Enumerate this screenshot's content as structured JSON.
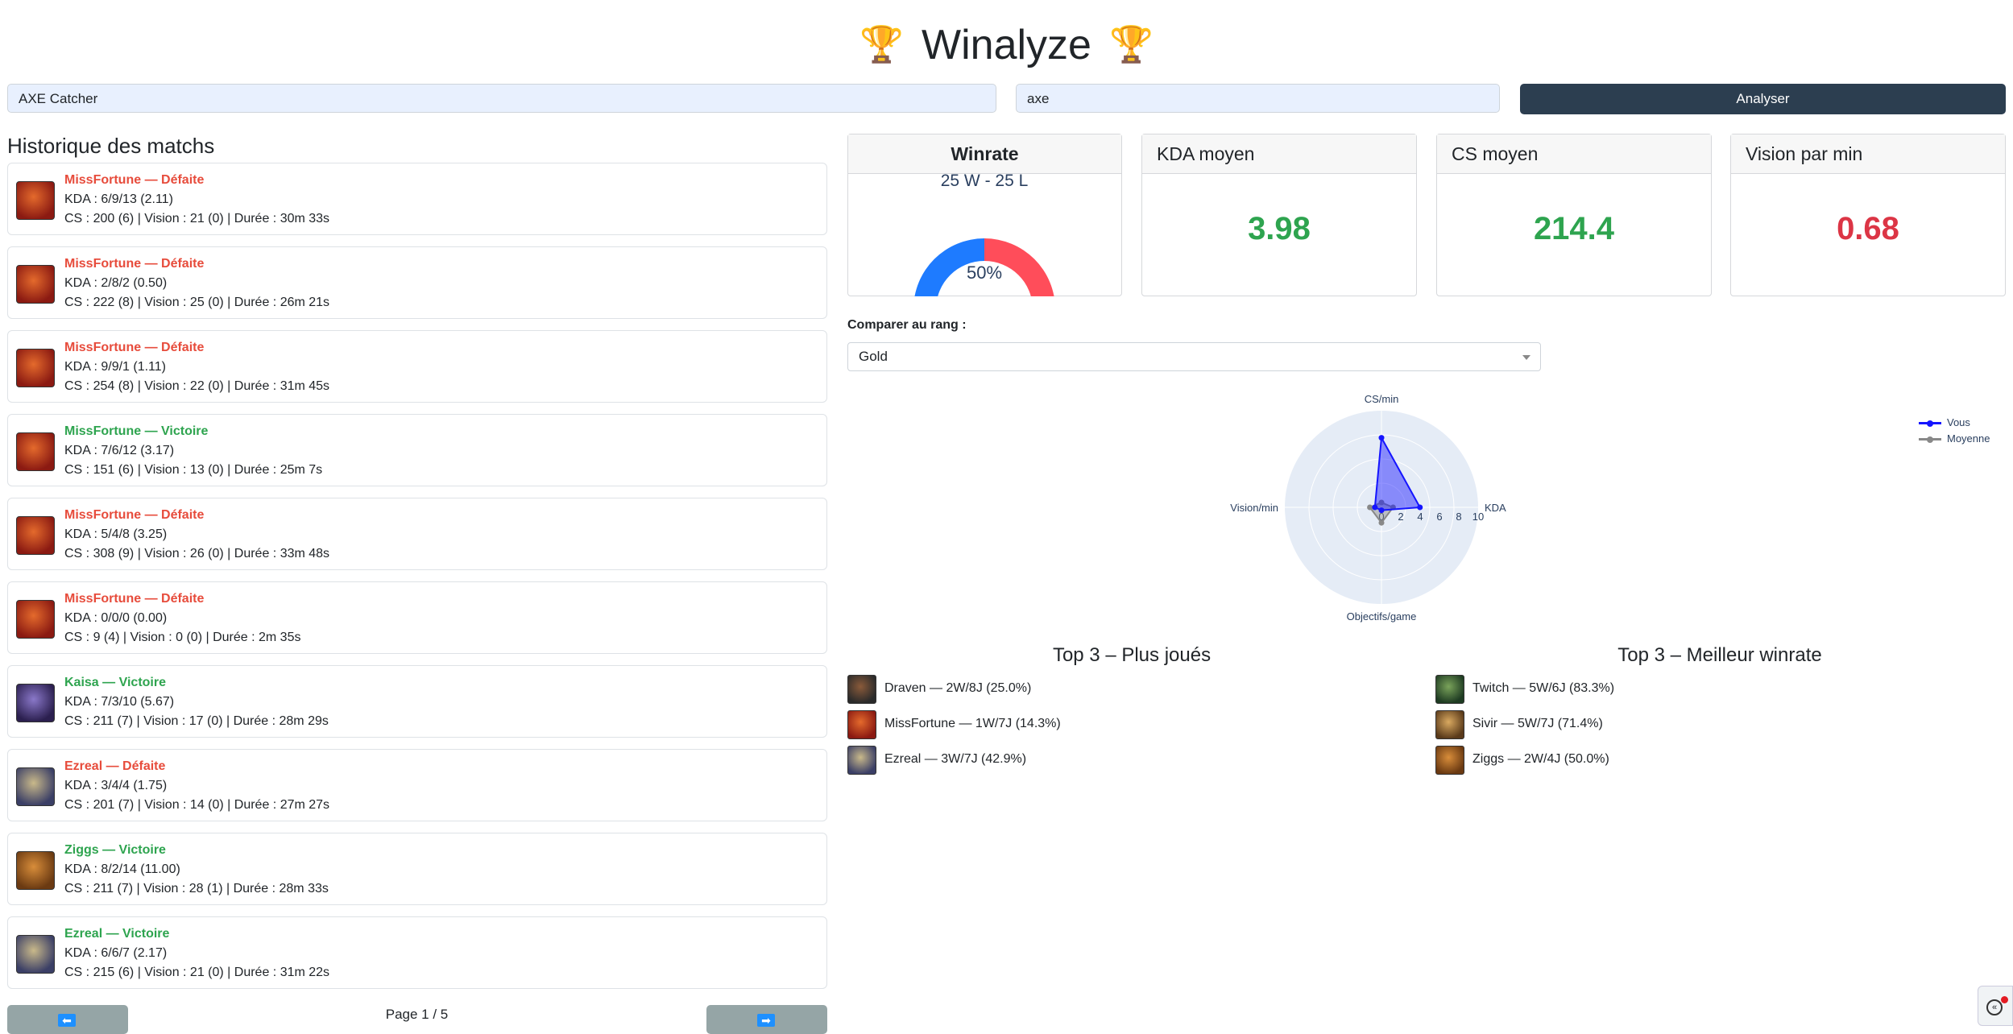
{
  "header": {
    "title": "Winalyze",
    "trophy": "🏆"
  },
  "search": {
    "summoner": "AXE Catcher",
    "tag": "axe",
    "analyze_label": "Analyser"
  },
  "history": {
    "title": "Historique des matchs",
    "matches": [
      {
        "title": "MissFortune — Défaite",
        "result": "loss",
        "kda": "KDA : 6/9/13 (2.11)",
        "stats": "CS : 200 (6) | Vision : 21 (0) | Durée : 30m 33s",
        "champion": "MissFortune"
      },
      {
        "title": "MissFortune — Défaite",
        "result": "loss",
        "kda": "KDA : 2/8/2 (0.50)",
        "stats": "CS : 222 (8) | Vision : 25 (0) | Durée : 26m 21s",
        "champion": "MissFortune"
      },
      {
        "title": "MissFortune — Défaite",
        "result": "loss",
        "kda": "KDA : 9/9/1 (1.11)",
        "stats": "CS : 254 (8) | Vision : 22 (0) | Durée : 31m 45s",
        "champion": "MissFortune"
      },
      {
        "title": "MissFortune — Victoire",
        "result": "win",
        "kda": "KDA : 7/6/12 (3.17)",
        "stats": "CS : 151 (6) | Vision : 13 (0) | Durée : 25m 7s",
        "champion": "MissFortune"
      },
      {
        "title": "MissFortune — Défaite",
        "result": "loss",
        "kda": "KDA : 5/4/8 (3.25)",
        "stats": "CS : 308 (9) | Vision : 26 (0) | Durée : 33m 48s",
        "champion": "MissFortune"
      },
      {
        "title": "MissFortune — Défaite",
        "result": "loss",
        "kda": "KDA : 0/0/0 (0.00)",
        "stats": "CS : 9 (4) | Vision : 0 (0) | Durée : 2m 35s",
        "champion": "MissFortune"
      },
      {
        "title": "Kaisa — Victoire",
        "result": "win",
        "kda": "KDA : 7/3/10 (5.67)",
        "stats": "CS : 211 (7) | Vision : 17 (0) | Durée : 28m 29s",
        "champion": "Kaisa"
      },
      {
        "title": "Ezreal — Défaite",
        "result": "loss",
        "kda": "KDA : 3/4/4 (1.75)",
        "stats": "CS : 201 (7) | Vision : 14 (0) | Durée : 27m 27s",
        "champion": "Ezreal"
      },
      {
        "title": "Ziggs — Victoire",
        "result": "win",
        "kda": "KDA : 8/2/14 (11.00)",
        "stats": "CS : 211 (7) | Vision : 28 (1) | Durée : 28m 33s",
        "champion": "Ziggs"
      },
      {
        "title": "Ezreal — Victoire",
        "result": "win",
        "kda": "KDA : 6/6/7 (2.17)",
        "stats": "CS : 215 (6) | Vision : 21 (0) | Durée : 31m 22s",
        "champion": "Ezreal"
      }
    ],
    "page_label": "Page 1 / 5",
    "prev_icon": "⬅",
    "next_icon": "➡"
  },
  "stats": {
    "winrate_title": "Winrate",
    "winrate_record": "25 W - 25 L",
    "winrate_pct": "50%",
    "winrate_fraction": 0.5,
    "kda_title": "KDA moyen",
    "kda_value": "3.98",
    "cs_title": "CS moyen",
    "cs_value": "214.4",
    "vision_title": "Vision par min",
    "vision_value": "0.68",
    "colors": {
      "win": "#1e7bff",
      "loss": "#ff4d5a",
      "good": "#2ea44f",
      "bad": "#dc3545"
    }
  },
  "compare": {
    "label": "Comparer au rang :",
    "selected": "Gold"
  },
  "chart_data": {
    "type": "radar",
    "axes": [
      "CS/min",
      "KDA",
      "Objectifs/game",
      "Vision/min"
    ],
    "radial_range": [
      0,
      10
    ],
    "radial_ticks": [
      "0",
      "2",
      "4",
      "6",
      "8",
      "10"
    ],
    "series": [
      {
        "name": "Vous",
        "values": [
          7.2,
          3.98,
          0.3,
          0.68
        ],
        "color": "#1515ff"
      },
      {
        "name": "Moyenne",
        "values": [
          0.5,
          1.2,
          1.6,
          1.2
        ],
        "color": "#888888"
      }
    ],
    "legend_position": "top-right"
  },
  "top_played": {
    "title": "Top 3 – Plus joués",
    "items": [
      {
        "text": "Draven — 2W/8J (25.0%)",
        "champion": "Draven"
      },
      {
        "text": "MissFortune — 1W/7J (14.3%)",
        "champion": "MissFortune"
      },
      {
        "text": "Ezreal — 3W/7J (42.9%)",
        "champion": "Ezreal"
      }
    ]
  },
  "top_winrate": {
    "title": "Top 3 – Meilleur winrate",
    "items": [
      {
        "text": "Twitch — 5W/6J (83.3%)",
        "champion": "Twitch"
      },
      {
        "text": "Sivir — 5W/7J (71.4%)",
        "champion": "Sivir"
      },
      {
        "text": "Ziggs — 2W/4J (50.0%)",
        "champion": "Ziggs"
      }
    ]
  }
}
